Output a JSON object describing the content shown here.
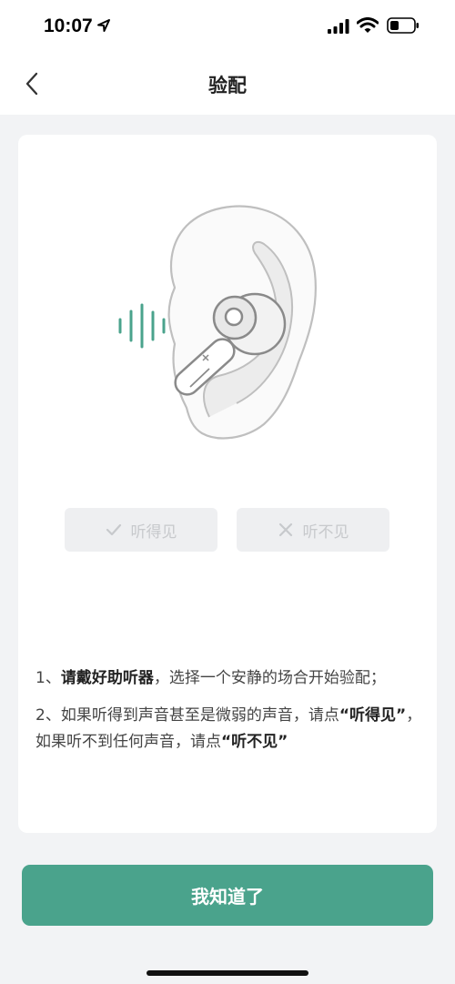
{
  "status_bar": {
    "time": "10:07",
    "icons": [
      "location-arrow-icon",
      "cellular-signal-icon",
      "wifi-icon",
      "battery-icon"
    ]
  },
  "nav": {
    "title": "验配",
    "back_icon": "chevron-left-icon"
  },
  "illustration": {
    "icons": [
      "sound-wave-icon",
      "ear-with-hearing-aid-icon"
    ],
    "accent_color": "#4aa38c"
  },
  "options": {
    "hear": {
      "icon": "check-icon",
      "label": "听得见"
    },
    "no_hear": {
      "icon": "x-icon",
      "label": "听不见"
    },
    "state": "disabled"
  },
  "instructions": {
    "step1": {
      "prefix": "1、",
      "bold": "请戴好助听器",
      "rest": "，选择一个安静的场合开始验配；"
    },
    "step2": {
      "prefix": "2、如果听得到声音甚至是微弱的声音，请点",
      "bold1": "“听得见”",
      "middle": "，如果听不到任何声音，请点",
      "bold2": "“听不见”"
    }
  },
  "confirm_button": {
    "label": "我知道了",
    "color": "#4aa38c"
  }
}
